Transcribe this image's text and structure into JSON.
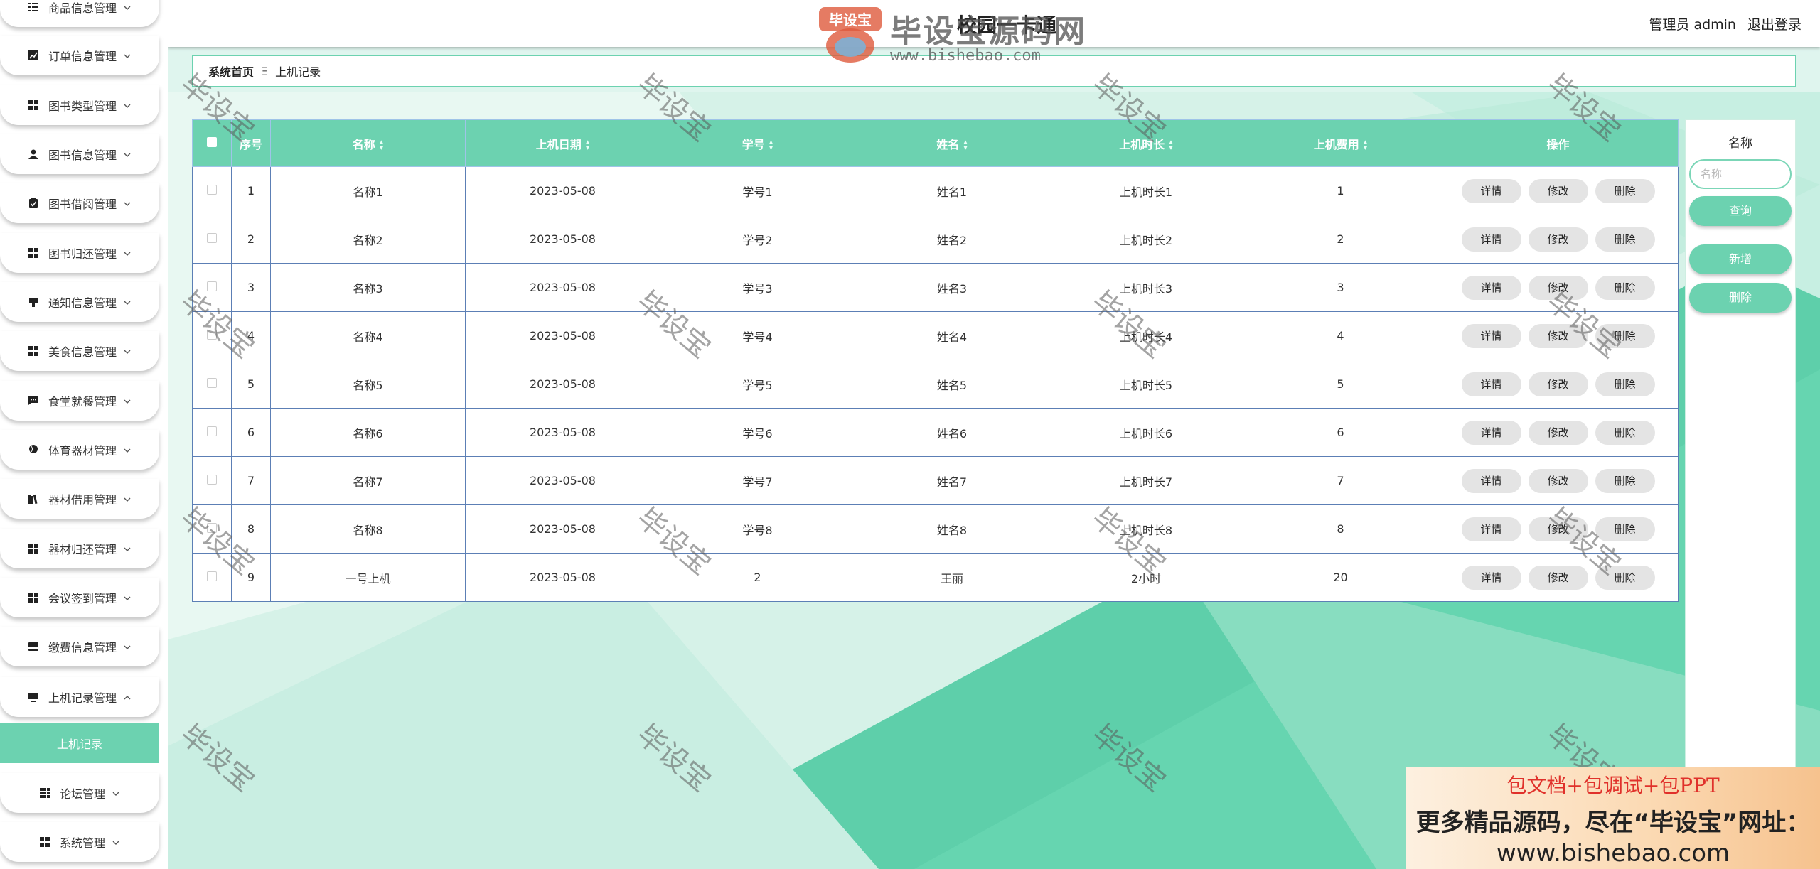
{
  "app": {
    "title": "校园一卡通"
  },
  "header": {
    "role": "管理员",
    "username": "admin",
    "logout": "退出登录"
  },
  "sidebar": {
    "items": [
      {
        "label": "商品信息管理",
        "icon": "list-icon"
      },
      {
        "label": "订单信息管理",
        "icon": "chart-icon"
      },
      {
        "label": "图书类型管理",
        "icon": "grid-icon"
      },
      {
        "label": "图书信息管理",
        "icon": "user-icon"
      },
      {
        "label": "图书借阅管理",
        "icon": "clipboard-icon"
      },
      {
        "label": "图书归还管理",
        "icon": "grid-icon"
      },
      {
        "label": "通知信息管理",
        "icon": "megaphone-icon"
      },
      {
        "label": "美食信息管理",
        "icon": "grid-icon"
      },
      {
        "label": "食堂就餐管理",
        "icon": "chat-icon"
      },
      {
        "label": "体育器材管理",
        "icon": "balloon-icon"
      },
      {
        "label": "器材借用管理",
        "icon": "books-icon"
      },
      {
        "label": "器材归还管理",
        "icon": "grid-icon"
      },
      {
        "label": "会议签到管理",
        "icon": "grid-icon"
      },
      {
        "label": "缴费信息管理",
        "icon": "card-icon"
      },
      {
        "label": "上机记录管理",
        "icon": "monitor-icon",
        "expanded": true
      },
      {
        "label": "论坛管理",
        "icon": "apps-icon"
      },
      {
        "label": "系统管理",
        "icon": "grid-icon"
      }
    ],
    "active_sub": "上机记录"
  },
  "breadcrumb": {
    "home": "系统首页",
    "separator": "Ξ",
    "current": "上机记录"
  },
  "table": {
    "columns": [
      "序号",
      "名称",
      "上机日期",
      "学号",
      "姓名",
      "上机时长",
      "上机费用",
      "操作"
    ],
    "rows": [
      {
        "idx": "1",
        "name": "名称1",
        "date": "2023-05-08",
        "sid": "学号1",
        "sname": "姓名1",
        "duration": "上机时长1",
        "fee": "1"
      },
      {
        "idx": "2",
        "name": "名称2",
        "date": "2023-05-08",
        "sid": "学号2",
        "sname": "姓名2",
        "duration": "上机时长2",
        "fee": "2"
      },
      {
        "idx": "3",
        "name": "名称3",
        "date": "2023-05-08",
        "sid": "学号3",
        "sname": "姓名3",
        "duration": "上机时长3",
        "fee": "3"
      },
      {
        "idx": "4",
        "name": "名称4",
        "date": "2023-05-08",
        "sid": "学号4",
        "sname": "姓名4",
        "duration": "上机时长4",
        "fee": "4"
      },
      {
        "idx": "5",
        "name": "名称5",
        "date": "2023-05-08",
        "sid": "学号5",
        "sname": "姓名5",
        "duration": "上机时长5",
        "fee": "5"
      },
      {
        "idx": "6",
        "name": "名称6",
        "date": "2023-05-08",
        "sid": "学号6",
        "sname": "姓名6",
        "duration": "上机时长6",
        "fee": "6"
      },
      {
        "idx": "7",
        "name": "名称7",
        "date": "2023-05-08",
        "sid": "学号7",
        "sname": "姓名7",
        "duration": "上机时长7",
        "fee": "7"
      },
      {
        "idx": "8",
        "name": "名称8",
        "date": "2023-05-08",
        "sid": "学号8",
        "sname": "姓名8",
        "duration": "上机时长8",
        "fee": "8"
      },
      {
        "idx": "9",
        "name": "一号上机",
        "date": "2023-05-08",
        "sid": "2",
        "sname": "王丽",
        "duration": "2小时",
        "fee": "20"
      }
    ],
    "actions": {
      "detail": "详情",
      "edit": "修改",
      "delete": "删除"
    }
  },
  "search": {
    "label": "名称",
    "placeholder": "名称",
    "query_button": "查询",
    "add_button": "新增",
    "delete_button": "删除"
  },
  "watermark": {
    "text": "毕设宝",
    "logo_title": "毕设宝源码网",
    "logo_url": "www.bishebao.com",
    "logo_badge": "毕设宝"
  },
  "promo": {
    "line1": "包文档+包调试+包PPT",
    "line2": "更多精品源码，尽在“毕设宝”网址：",
    "line3": "www.bishebao.com"
  },
  "colors": {
    "accent": "#6cd2b0",
    "accent_dark": "#5bc7a2"
  }
}
